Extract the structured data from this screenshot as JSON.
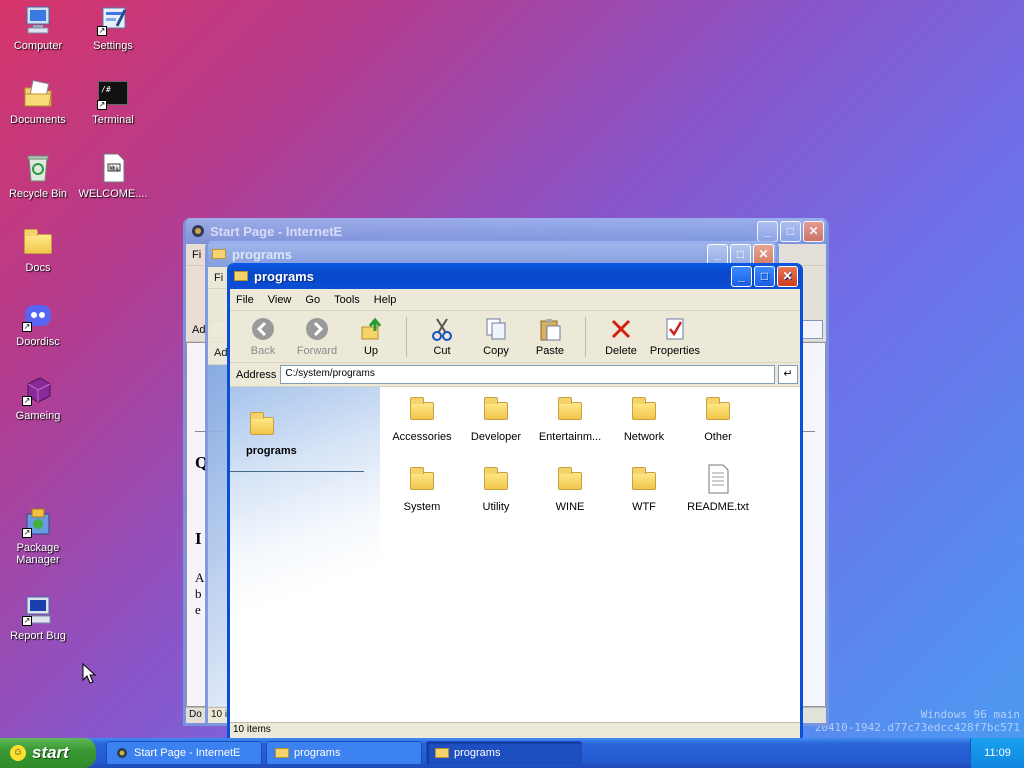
{
  "desktop": {
    "icons": [
      {
        "label": "Computer",
        "icon": "computer-icon"
      },
      {
        "label": "Settings",
        "icon": "settings-icon"
      },
      {
        "label": "Documents",
        "icon": "documents-icon"
      },
      {
        "label": "Terminal",
        "icon": "terminal-icon"
      },
      {
        "label": "Recycle Bin",
        "icon": "recycle-bin-icon"
      },
      {
        "label": "WELCOME....",
        "icon": "welcome-file-icon"
      },
      {
        "label": "Docs",
        "icon": "folder-icon"
      },
      {
        "label": "Doordisc",
        "icon": "discord-icon"
      },
      {
        "label": "Gameing",
        "icon": "gaming-icon"
      },
      {
        "label": "Package Manager",
        "icon": "package-manager-icon"
      },
      {
        "label": "Report Bug",
        "icon": "report-bug-icon"
      }
    ],
    "terminal_glyph": "/#",
    "watermark_line1": "Windows 96 main",
    "watermark_line2": "20410-1942.d77c73edcc428f7bc571"
  },
  "windows": {
    "ie": {
      "title": "Start Page - InternetE",
      "menu_first": "Fi",
      "addr_label": "Ad",
      "status": "Do",
      "page_text": {
        "q": "Q",
        "i": "I",
        "a": "A",
        "b": "b",
        "e": "e"
      }
    },
    "explorer_back": {
      "title": "programs",
      "menu_first": "Fi",
      "addr_label": "Ad",
      "status": "10 i"
    },
    "explorer": {
      "title": "programs",
      "menu": [
        "File",
        "View",
        "Go",
        "Tools",
        "Help"
      ],
      "toolbar": {
        "back": "Back",
        "forward": "Forward",
        "up": "Up",
        "cut": "Cut",
        "copy": "Copy",
        "paste": "Paste",
        "delete": "Delete",
        "properties": "Properties"
      },
      "address_label": "Address",
      "address_value": "C:/system/programs",
      "go_glyph": "↵",
      "sidebar_title": "programs",
      "files": [
        {
          "name": "Accessories",
          "type": "folder"
        },
        {
          "name": "Developer",
          "type": "folder"
        },
        {
          "name": "Entertainm...",
          "type": "folder"
        },
        {
          "name": "Network",
          "type": "folder"
        },
        {
          "name": "Other",
          "type": "folder"
        },
        {
          "name": "System",
          "type": "folder"
        },
        {
          "name": "Utility",
          "type": "folder"
        },
        {
          "name": "WINE",
          "type": "folder"
        },
        {
          "name": "WTF",
          "type": "folder"
        },
        {
          "name": "README.txt",
          "type": "text-file"
        }
      ],
      "status": "10 items"
    }
  },
  "taskbar": {
    "start_label": "start",
    "tasks": [
      {
        "label": "Start Page - InternetE",
        "icon": "ie-icon",
        "active": false
      },
      {
        "label": "programs",
        "icon": "folder-icon",
        "active": false
      },
      {
        "label": "programs",
        "icon": "folder-icon",
        "active": true
      }
    ],
    "clock": "11:09"
  },
  "colors": {
    "accent": "#0a4fd6",
    "start_green": "#3a9a34",
    "tray_blue": "#0f86e0"
  }
}
